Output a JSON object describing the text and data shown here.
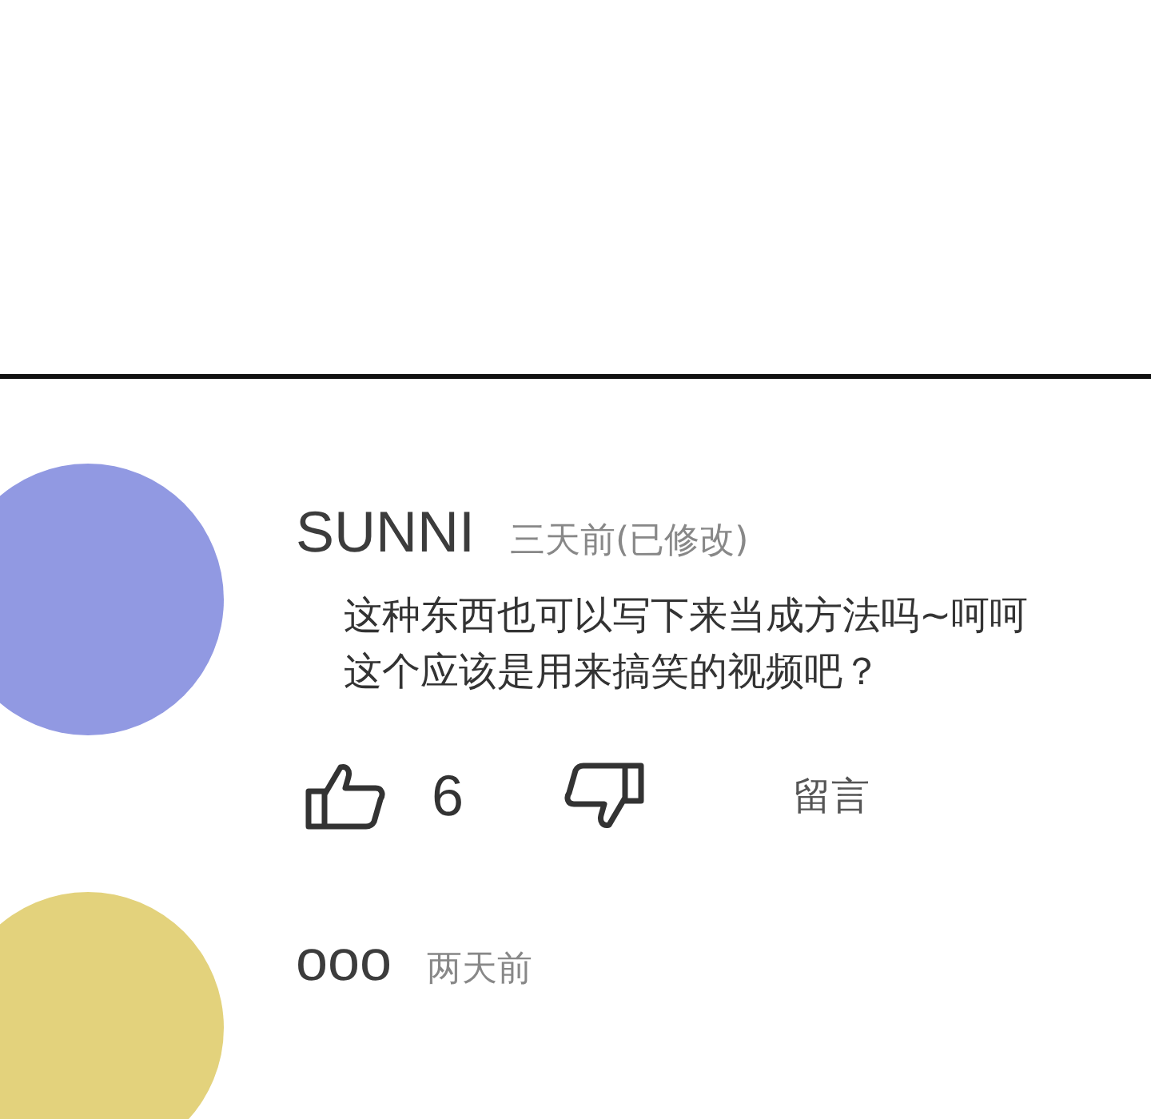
{
  "comments": [
    {
      "name": "SUNNI",
      "time": "三天前(已修改)",
      "color": "#9199e2",
      "lines": [
        "这种东西也可以写下来当成方法吗~呵呵",
        "这个应该是用来搞笑的视频吧？"
      ],
      "likes": "6",
      "reply": "留言"
    },
    {
      "name": "ooo",
      "time": "两天前",
      "color": "#e3d27c"
    }
  ]
}
